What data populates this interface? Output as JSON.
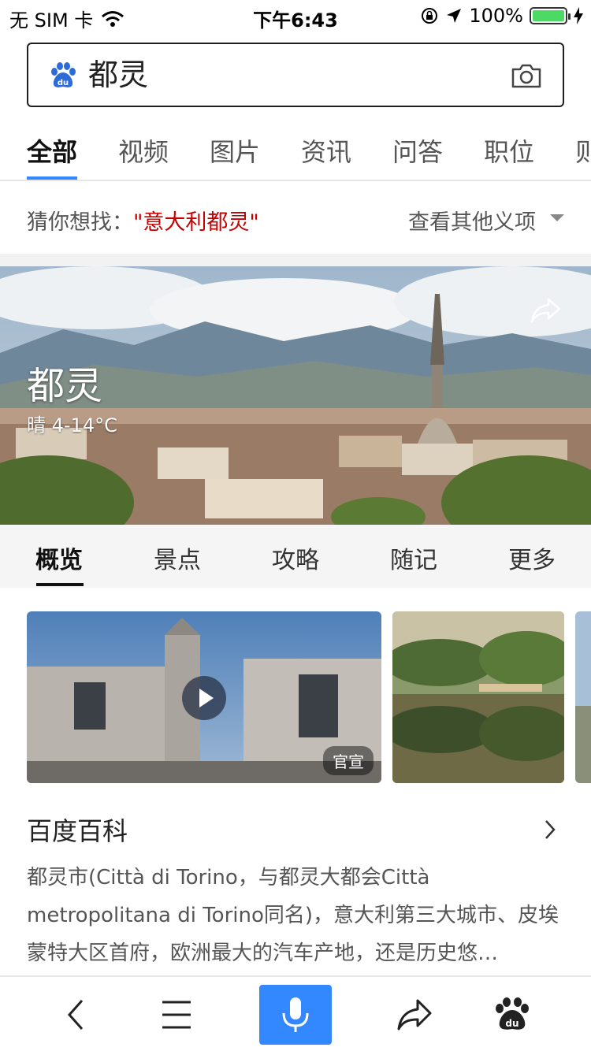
{
  "status_bar": {
    "carrier": "无 SIM 卡",
    "time": "下午6:43",
    "battery_percent": "100%",
    "battery_level": 1.0,
    "icons": [
      "wifi-icon",
      "rotation-lock-icon",
      "location-icon",
      "battery-icon",
      "charging-icon"
    ]
  },
  "search": {
    "query": "都灵",
    "logo_text": "du",
    "icons": [
      "baidu-paw-icon",
      "camera-icon"
    ]
  },
  "top_tabs": {
    "items": [
      "全部",
      "视频",
      "图片",
      "资讯",
      "问答",
      "职位",
      "则"
    ],
    "active_index": 0
  },
  "guess": {
    "prefix": "猜你想找：",
    "term": "\"意大利都灵\"",
    "other_label": "查看其他义项"
  },
  "hero": {
    "city": "都灵",
    "weather": "晴 4-14°C",
    "icons": [
      "share-icon"
    ]
  },
  "section_tabs": {
    "items": [
      "概览",
      "景点",
      "攻略",
      "随记",
      "更多"
    ],
    "active_index": 0
  },
  "media": {
    "video_badge": "官宣",
    "icons": [
      "play-icon"
    ]
  },
  "baike": {
    "title": "百度百科",
    "text": "都灵市(Città di Torino，与都灵大都会Città metropolitana di Torino同名)，意大利第三大城市、皮埃蒙特大区首府，欧洲最大的汽车产地，还是历史悠…"
  },
  "bottom_bar": {
    "icons": [
      "back-icon",
      "menu-icon",
      "microphone-icon",
      "share-icon",
      "baidu-paw-icon"
    ]
  },
  "colors": {
    "accent": "#3388ff",
    "highlight_red": "#c40000",
    "battery_green": "#4cd964"
  }
}
